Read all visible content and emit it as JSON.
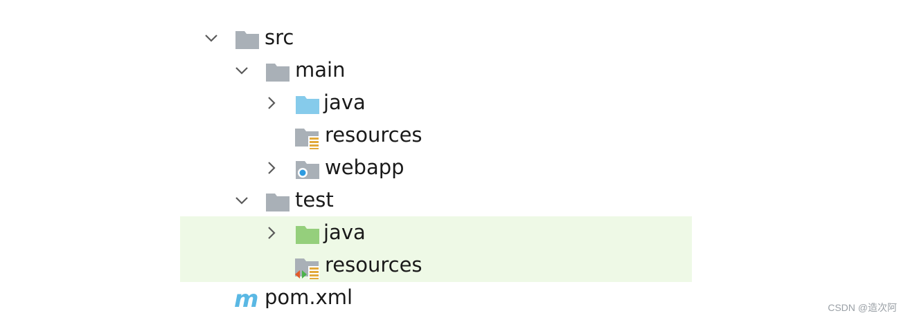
{
  "tree": {
    "src": "src",
    "main": "main",
    "main_java": "java",
    "main_resources": "resources",
    "webapp": "webapp",
    "test": "test",
    "test_java": "java",
    "test_resources": "resources",
    "pom": "pom.xml"
  },
  "colors": {
    "folder_gray": "#a9b0b7",
    "source_folder_blue": "#86cbeb",
    "test_folder_green": "#95cf7c",
    "highlight": "#eef9e6",
    "maven_m": "#5ab8e4"
  },
  "icons": {
    "src": "folder-icon",
    "main": "folder-icon",
    "main_java": "source-folder-icon",
    "main_resources": "resources-folder-icon",
    "webapp": "web-folder-icon",
    "test": "folder-icon",
    "test_java": "test-source-folder-icon",
    "test_resources": "test-resources-folder-icon",
    "pom": "maven-icon"
  },
  "watermark": "CSDN @造次阿"
}
